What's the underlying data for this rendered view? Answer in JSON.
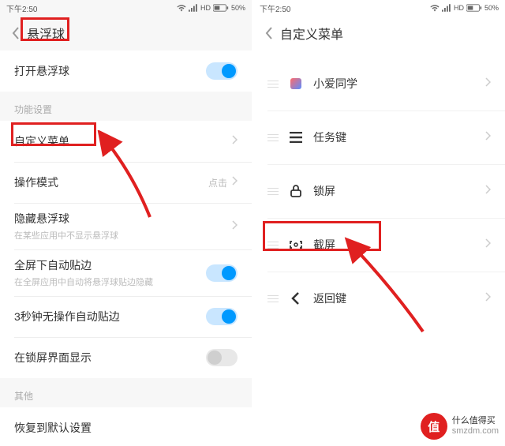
{
  "status": {
    "time": "下午2:50",
    "hd": "HD",
    "battery": "50%"
  },
  "left": {
    "title": "悬浮球",
    "sections": {
      "top": {
        "open_label": "打开悬浮球"
      },
      "func_header": "功能设置",
      "func": {
        "custom_menu": "自定义菜单",
        "mode_label": "操作模式",
        "mode_value": "点击",
        "hide_label": "隐藏悬浮球",
        "hide_sub": "在某些应用中不显示悬浮球",
        "fullscreen_label": "全屏下自动贴边",
        "fullscreen_sub": "在全屏应用中自动将悬浮球贴边隐藏",
        "idle_label": "3秒钟无操作自动贴边",
        "lockscreen_label": "在锁屏界面显示"
      },
      "other_header": "其他",
      "other": {
        "reset_label": "恢复到默认设置"
      }
    }
  },
  "right": {
    "title": "自定义菜单",
    "items": [
      {
        "label": "小爱同学",
        "icon": "xiaoai"
      },
      {
        "label": "任务键",
        "icon": "tasks"
      },
      {
        "label": "锁屏",
        "icon": "lock"
      },
      {
        "label": "截屏",
        "icon": "screenshot"
      },
      {
        "label": "返回键",
        "icon": "back"
      }
    ]
  },
  "watermark": {
    "badge": "值",
    "line1": "什么值得买",
    "line2": "smzdm.com"
  }
}
